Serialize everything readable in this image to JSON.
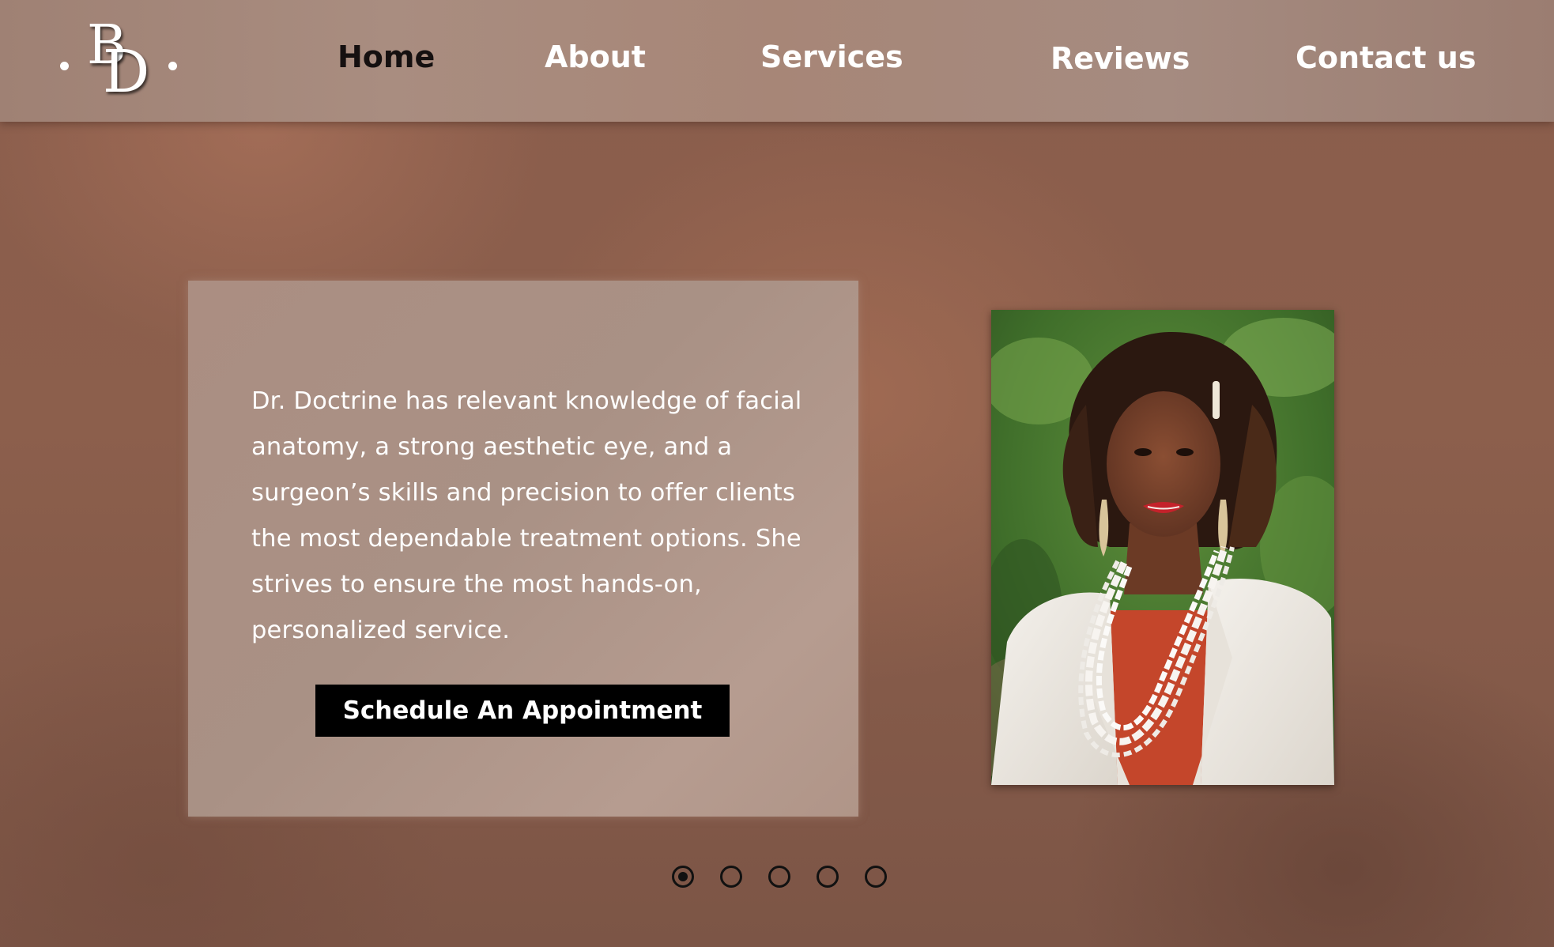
{
  "brand": {
    "logo_text": "BD",
    "logo_letters": [
      "B",
      "D"
    ]
  },
  "nav": {
    "items": [
      {
        "label": "Home",
        "active": true
      },
      {
        "label": "About",
        "active": false
      },
      {
        "label": "Services",
        "active": false
      },
      {
        "label": "Reviews",
        "active": false
      },
      {
        "label": "Contact us",
        "active": false
      }
    ]
  },
  "hero": {
    "bio": "Dr. Doctrine has relevant knowledge of facial anatomy, a strong aesthetic eye, and a surgeon’s skills and precision to offer clients the most dependable treatment options. She strives to ensure the most hands-on, personalized service.",
    "cta_label": "Schedule An Appointment"
  },
  "carousel": {
    "slide_count": 5,
    "active_index": 0
  },
  "colors": {
    "background": "#8a5d4c",
    "header": "#a58a7e",
    "card": "#ad9286",
    "cta_bg": "#000000",
    "nav_active": "#151010",
    "nav_text": "#ffffff"
  }
}
